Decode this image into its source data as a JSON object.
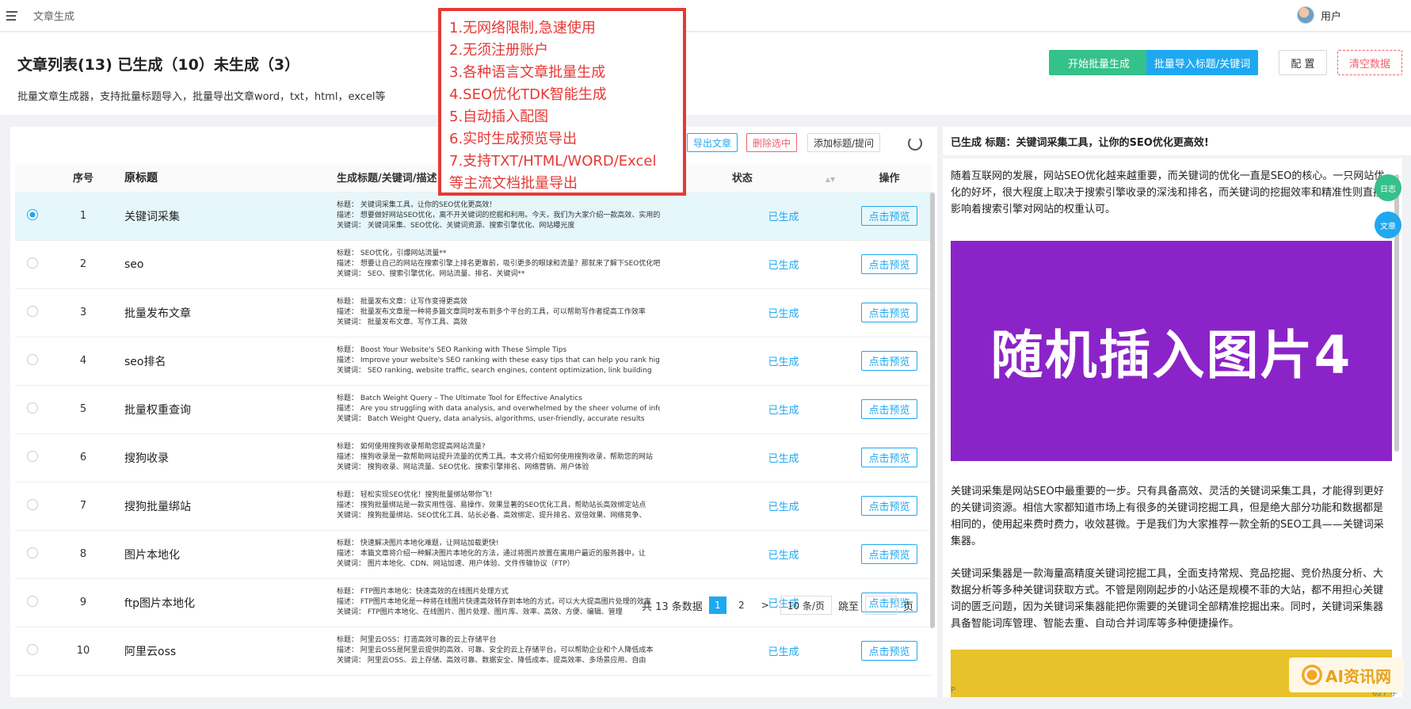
{
  "topbar": {
    "breadcrumb": "文章生成",
    "user": "用户"
  },
  "header": {
    "title": "文章列表(13) 已生成（10）未生成（3）",
    "description": "批量文章生成器，支持批量标题导入，批量导出文章word，txt，html，excel等",
    "buttons": {
      "start": "开始批量生成",
      "import": "批量导入标题/关键词",
      "config": "配 置",
      "clear": "清空数据"
    }
  },
  "toolbar": {
    "export": "导出文章",
    "delete": "删除选中",
    "add": "添加标题/提问"
  },
  "table": {
    "headers": {
      "index": "序号",
      "title": "原标题",
      "generated": "生成标题/关键词/描述",
      "status": "状态",
      "action": "操作"
    },
    "rows": [
      {
        "index": "1",
        "title": "关键词采集",
        "gen": [
          "标题： 关键词采集工具，让你的SEO优化更高效！",
          "描述： 想要做好网站SEO优化，离不开关键词的挖掘和利用。今天，我们为大家介绍一款高效、实用的关键词采集工具",
          "关键词： 关键词采集、SEO优化、关键词资源、搜索引擎优化、网站曝光度"
        ],
        "status": "已生成",
        "action": "点击预览"
      },
      {
        "index": "2",
        "title": "seo",
        "gen": [
          "标题： SEO优化，引爆网站流量**",
          "描述： 想要让自己的网站在搜索引擎上排名更靠前，吸引更多的眼球和流量？那就来了解下SEO优化吧",
          "关键词： SEO、搜索引擎优化、网站流量、排名、关键词**"
        ],
        "status": "已生成",
        "action": "点击预览"
      },
      {
        "index": "3",
        "title": "批量发布文章",
        "gen": [
          "标题： 批量发布文章：让写作变得更高效",
          "描述： 批量发布文章是一种将多篇文章同时发布到多个平台的工具，可以帮助写作者提高工作效率",
          "关键词： 批量发布文章、写作工具、高效"
        ],
        "status": "已生成",
        "action": "点击预览"
      },
      {
        "index": "4",
        "title": "seo排名",
        "gen": [
          "标题： Boost Your Website's SEO Ranking with These Simple Tips",
          "描述： Improve your website's SEO ranking with these easy tips that can help you rank higher",
          "关键词： SEO ranking, website traffic, search engines, content optimization, link building"
        ],
        "status": "已生成",
        "action": "点击预览"
      },
      {
        "index": "5",
        "title": "批量权重查询",
        "gen": [
          "标题： Batch Weight Query – The Ultimate Tool for Effective Analytics",
          "描述： Are you struggling with data analysis, and overwhelmed by the sheer volume of information",
          "关键词： Batch Weight Query, data analysis, algorithms, user-friendly, accurate results"
        ],
        "status": "已生成",
        "action": "点击预览"
      },
      {
        "index": "6",
        "title": "搜狗收录",
        "gen": [
          "标题： 如何使用搜狗收录帮助您提高网站流量?",
          "描述： 搜狗收录是一款帮助网站提升流量的优秀工具。本文将介绍如何使用搜狗收录，帮助您的网站",
          "关键词： 搜狗收录、网站流量、SEO优化、搜索引擎排名、网络营销、用户体验"
        ],
        "status": "已生成",
        "action": "点击预览"
      },
      {
        "index": "7",
        "title": "搜狗批量绑站",
        "gen": [
          "标题： 轻松实现SEO优化！搜狗批量绑站带你飞！",
          "描述： 搜狗批量绑站是一款实用性强、易操作、效果显著的SEO优化工具，帮助站长高效绑定站点",
          "关键词： 搜狗批量绑站、SEO优化工具、站长必备、高效绑定、提升排名、双倍效果、网络竞争、"
        ],
        "status": "已生成",
        "action": "点击预览"
      },
      {
        "index": "8",
        "title": "图片本地化",
        "gen": [
          "标题： 快速解决图片本地化难题，让网站加载更快!",
          "描述： 本篇文章将介绍一种解决图片本地化的方法，通过将图片放置在离用户最近的服务器中，让",
          "关键词： 图片本地化、CDN、网站加速、用户体验、文件传输协议（FTP）"
        ],
        "status": "已生成",
        "action": "点击预览"
      },
      {
        "index": "9",
        "title": "ftp图片本地化",
        "gen": [
          "标题： FTP图片本地化：快速高效的在线图片处理方式",
          "描述： FTP图片本地化是一种将在线图片快速高效转存到本地的方式，可以大大提高图片处理的效率",
          "关键词： FTP图片本地化、在线图片、图片处理、图片库、效率、高效、方便、编辑、管理"
        ],
        "status": "已生成",
        "action": "点击预览"
      },
      {
        "index": "10",
        "title": "阿里云oss",
        "gen": [
          "标题： 阿里云OSS：打造高效可靠的云上存储平台",
          "描述： 阿里云OSS是阿里云提供的高效、可靠、安全的云上存储平台，可以帮助企业和个人降低成本",
          "关键词： 阿里云OSS、云上存储、高效可靠、数据安全、降低成本、提高效率、多场景应用、自由"
        ],
        "status": "已生成",
        "action": "点击预览"
      }
    ]
  },
  "pagination": {
    "total": "共 13 条数据",
    "pages": [
      "1",
      "2"
    ],
    "next": ">",
    "page_size": "10 条/页",
    "jump_label": "跳至",
    "page_suffix": "页"
  },
  "preview": {
    "heading": "已生成 标题：关键词采集工具，让你的SEO优化更高效!",
    "intro": "随着互联网的发展，网站SEO优化越来越重要，而关键词的优化一直是SEO的核心。一只网站优化的好坏，很大程度上取决于搜索引擎收录的深浅和排名，而关键词的挖掘效率和精准性则直接影响着搜索引擎对网站的权重认可。",
    "image_text": "随机插入图片4",
    "para1": "关键词采集是网站SEO中最重要的一步。只有具备高效、灵活的关键词采集工具，才能得到更好的关键词资源。相信大家都知道市场上有很多的关键词挖掘工具，但是绝大部分功能和数据都是相同的，使用起来费时费力，收效甚微。于是我们为大家推荐一款全新的SEO工具——关键词采集器。",
    "para2": "关键词采集器是一款海量高精度关键词挖掘工具，全面支持常规、竞品挖掘、竞价热度分析、大数据分析等多种关键词获取方式。不管是刚刚起步的小站还是规模不菲的大站，都不用担心关键词的匮乏问题，因为关键词采集器能把你需要的关键词全部精准挖掘出来。同时，关键词采集器具备智能词库管理、智能去重、自动合并词库等多种便捷操作。",
    "footer_left": "P",
    "footer_count": "627 字",
    "float_log": "日志",
    "float_article": "文章"
  },
  "overlay": {
    "lines": [
      "1.无网络限制,急速使用",
      "2.无须注册账户",
      "3.各种语言文章批量生成",
      "4.SEO优化TDK智能生成",
      "5.自动插入配图",
      "6.实时生成预览导出",
      "7.支持TXT/HTML/WORD/Excel",
      "等主流文档批量导出"
    ]
  },
  "watermark": "AI资讯网",
  "colors": {
    "green": "#35c18a",
    "blue": "#1fa8f0",
    "red": "#e53935",
    "purple": "#8b24c8"
  }
}
